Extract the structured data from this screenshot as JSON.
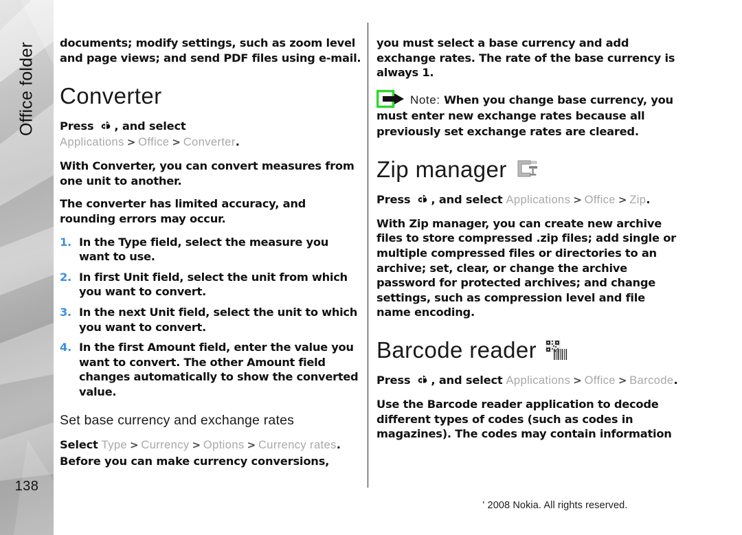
{
  "sidebar": {
    "chapter_label": "Office folder",
    "page_number": "138"
  },
  "footer": {
    "copyright": "' 2008 Nokia. All rights reserved."
  },
  "left_column": {
    "intro_paragraph": "documents; modify settings, such as zoom level and page views; and send PDF files using e-mail.",
    "converter": {
      "title": "Converter",
      "press_label": "Press",
      "key_icon": "nokia-menu-key-icon",
      "and_select_label": ", and select",
      "path": [
        "Applications",
        "Office",
        "Converter"
      ],
      "path_separator": ">",
      "period": ".",
      "paragraphs": [
        "With Converter, you can convert measures from one unit to another.",
        "The converter has limited accuracy, and rounding errors may occur."
      ],
      "steps": [
        {
          "num": "1.",
          "text": "In the Type field, select the measure you want to use."
        },
        {
          "num": "2.",
          "text": "In first Unit field, select the unit from which you want to convert."
        },
        {
          "num": "3.",
          "text": "In the next Unit field, select the unit to which you want to convert."
        },
        {
          "num": "4.",
          "text": "In the first Amount field, enter the value you want to convert. The other Amount field changes automatically to show the converted value."
        }
      ],
      "subsection": {
        "title": "Set base currency and exchange rates",
        "select_label": "Select",
        "path": [
          "Type",
          "Currency",
          "Options",
          "Currency rates"
        ],
        "path_separator": ">",
        "trailing_text": ". Before you can make currency conversions,"
      }
    }
  },
  "right_column": {
    "continuation_paragraph": "you must select a base currency and add exchange rates. The rate of the base currency is always 1.",
    "note": {
      "icon": "note-arrow-icon",
      "label": "Note:",
      "text": "When you change base currency, you must enter new exchange rates because all previously set exchange rates are cleared."
    },
    "zip_manager": {
      "title": "Zip manager",
      "title_icon": "clamp-compression-icon",
      "press_label": "Press",
      "key_icon": "nokia-menu-key-icon",
      "and_select_label": ", and select",
      "path": [
        "Applications",
        "Office",
        "Zip"
      ],
      "path_separator": ">",
      "period": ".",
      "paragraph": "With Zip manager, you can create new archive files to store compressed .zip files; add single or multiple compressed files or directories to an archive; set, clear, or change the archive password for protected archives; and change settings, such as compression level and file name encoding."
    },
    "barcode_reader": {
      "title": "Barcode reader",
      "title_icon": "barcode-qr-icon",
      "press_label": "Press",
      "key_icon": "nokia-menu-key-icon",
      "and_select_label": ", and select",
      "path": [
        "Applications",
        "Office",
        "Barcode"
      ],
      "path_separator": ">",
      "period": ".",
      "paragraph": "Use the Barcode reader application to decode different types of codes (such as codes in magazines). The codes may contain information"
    }
  },
  "colors": {
    "step_number": "#3b8fe0",
    "ui_path": "#a8a8a8",
    "note_icon_green": "#2ad72a",
    "text": "#111111"
  }
}
